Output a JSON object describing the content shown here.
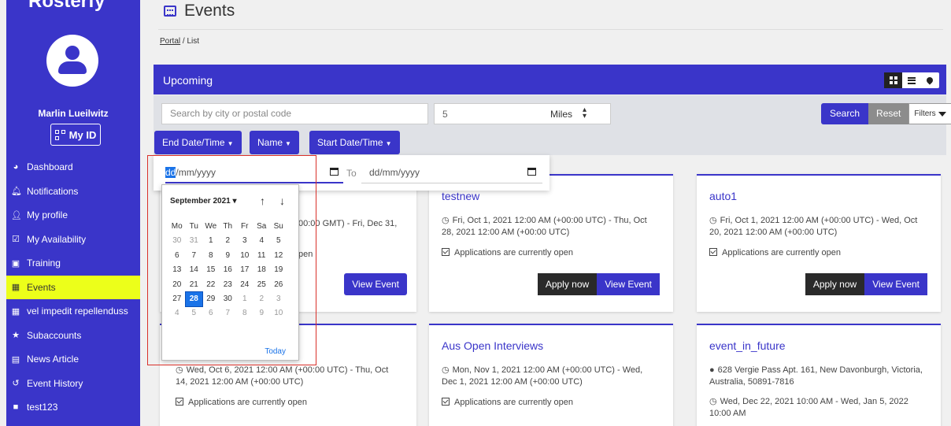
{
  "app": {
    "logo": "Rosterfy"
  },
  "user": {
    "name": "Marlin Lueilwitz",
    "myid_label": "My ID"
  },
  "sidebar": {
    "items": [
      {
        "label": "Dashboard",
        "icon": "dashboard-icon",
        "glyph": "◕"
      },
      {
        "label": "Notifications",
        "icon": "bell-icon",
        "glyph": "🔔︎"
      },
      {
        "label": "My profile",
        "icon": "user-icon",
        "glyph": "👤︎"
      },
      {
        "label": "My Availability",
        "icon": "calendar-check-icon",
        "glyph": "☑"
      },
      {
        "label": "Training",
        "icon": "chalkboard-icon",
        "glyph": "▣"
      },
      {
        "label": "Events",
        "icon": "calendar-icon",
        "glyph": "▦",
        "active": true
      },
      {
        "label": "vel impedit repellenduss",
        "icon": "calendar-icon",
        "glyph": "▦"
      },
      {
        "label": "Subaccounts",
        "icon": "star-icon",
        "glyph": "★"
      },
      {
        "label": "News Article",
        "icon": "newspaper-icon",
        "glyph": "▤"
      },
      {
        "label": "Event History",
        "icon": "history-icon",
        "glyph": "↺"
      },
      {
        "label": "test123",
        "icon": "square-b-icon",
        "glyph": "■"
      }
    ]
  },
  "header": {
    "title": "Events",
    "breadcrumb_link": "Portal",
    "breadcrumb_sep": "/",
    "breadcrumb_current": "List"
  },
  "upcoming": {
    "title": "Upcoming"
  },
  "search": {
    "placeholder": "Search by city or postal code",
    "distance_value": "5",
    "distance_unit": "Miles",
    "search_label": "Search",
    "reset_label": "Reset",
    "filters_label": "Filters"
  },
  "sort_buttons": {
    "end": "End Date/Time",
    "name": "Name",
    "start": "Start Date/Time"
  },
  "date_filter": {
    "from_sel": "dd",
    "from_rest": "/mm/yyyy",
    "to_label": "To",
    "to_placeholder": "dd/mm/yyyy"
  },
  "picker": {
    "month": "September 2021",
    "up": "↑",
    "down": "↓",
    "weekdays": [
      "Mo",
      "Tu",
      "We",
      "Th",
      "Fr",
      "Sa",
      "Su"
    ],
    "days": [
      [
        "30",
        "31",
        "1",
        "2",
        "3",
        "4",
        "5"
      ],
      [
        "6",
        "7",
        "8",
        "9",
        "10",
        "11",
        "12"
      ],
      [
        "13",
        "14",
        "15",
        "16",
        "17",
        "18",
        "19"
      ],
      [
        "20",
        "21",
        "22",
        "23",
        "24",
        "25",
        "26"
      ],
      [
        "27",
        "28",
        "29",
        "30",
        "1",
        "2",
        "3"
      ],
      [
        "4",
        "5",
        "6",
        "7",
        "8",
        "9",
        "10"
      ]
    ],
    "today_label": "Today"
  },
  "cards": {
    "c1": {
      "date_partial": "00:00 GMT) - Fri, Dec 31,",
      "open_partial": "pen",
      "view_label": "View Event"
    },
    "c2": {
      "title": "testnew",
      "date_line1": "Fri, Oct 1, 2021 12:00 AM (+00:00 UTC) - Thu, Oct",
      "date_line2": "28, 2021 12:00 AM (+00:00 UTC)",
      "status": "Applications are currently open",
      "apply_label": "Apply now",
      "view_label": "View Event"
    },
    "c3": {
      "title": "auto1",
      "date_line1": "Fri, Oct 1, 2021 12:00 AM (+00:00 UTC) - Wed, Oct",
      "date_line2": "20, 2021 12:00 AM (+00:00 UTC)",
      "status": "Applications are currently open",
      "apply_label": "Apply now",
      "view_label": "View Event"
    },
    "c4": {
      "date_line1": "Wed, Oct 6, 2021 12:00 AM (+00:00 UTC) - Thu, Oct",
      "date_line2": "14, 2021 12:00 AM (+00:00 UTC)",
      "status": "Applications are currently open"
    },
    "c5": {
      "title": "Aus Open Interviews",
      "date_line1": "Mon, Nov 1, 2021 12:00 AM (+00:00 UTC) - Wed,",
      "date_line2": "Dec 1, 2021 12:00 AM (+00:00 UTC)",
      "status": "Applications are currently open"
    },
    "c6": {
      "title": "event_in_future",
      "addr_line1": "628 Vergie Pass Apt. 161, New Davonburgh, Victoria,",
      "addr_line2": "Australia, 50891-7816",
      "date_line1": "Wed, Dec 22, 2021 10:00 AM - Wed, Jan 5, 2022",
      "date_line2": "10:00 AM"
    }
  },
  "colors": {
    "brand": "#3a35c9",
    "active_nav": "#ecff1a",
    "highlight_box": "#d9302a",
    "today": "#1a73e8"
  }
}
